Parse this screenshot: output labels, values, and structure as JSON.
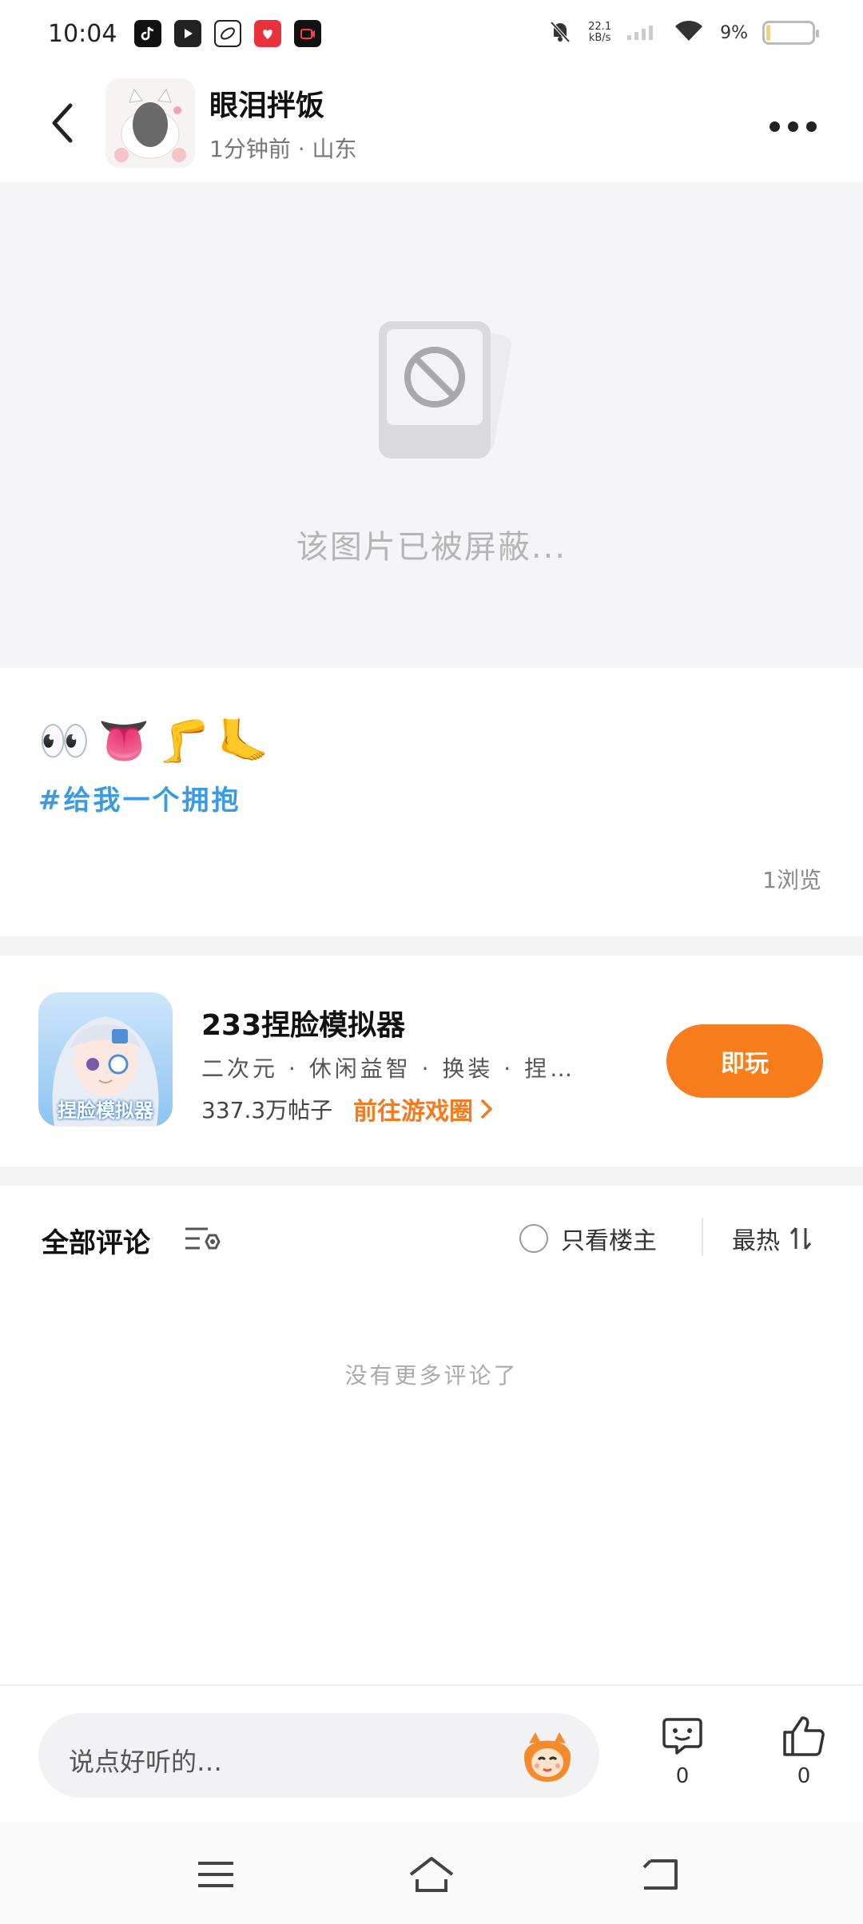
{
  "status_bar": {
    "time": "10:04",
    "net_speed_value": "22.1",
    "net_speed_unit": "kB/s",
    "battery_text": "9%",
    "battery_level": 0.09,
    "app_icons": [
      "tiktok-icon",
      "video-app-icon",
      "browser-icon",
      "gift-app-icon",
      "camera-app-icon"
    ]
  },
  "header": {
    "author_name": "眼泪拌饭",
    "post_meta": "1分钟前 · 山东"
  },
  "blocked_image": {
    "message": "该图片已被屏蔽..."
  },
  "post": {
    "emojis": [
      "👀",
      "👅",
      "🦵",
      "🦶"
    ],
    "hashtag": "#给我一个拥抱",
    "views": "1浏览"
  },
  "game": {
    "title": "233捏脸模拟器",
    "tags": "二次元 · 休闲益智 · 换装 · 捏…",
    "post_count": "337.3万帖子",
    "circle_link": "前往游戏圈",
    "play_button": "即玩",
    "icon_label": "捏脸模拟器",
    "accent_color": "#f97d1c"
  },
  "comments": {
    "title": "全部评论",
    "only_owner": "只看楼主",
    "sort": "最热",
    "empty_text": "没有更多评论了"
  },
  "bottom_bar": {
    "input_placeholder": "说点好听的…",
    "comment_count": "0",
    "like_count": "0"
  }
}
